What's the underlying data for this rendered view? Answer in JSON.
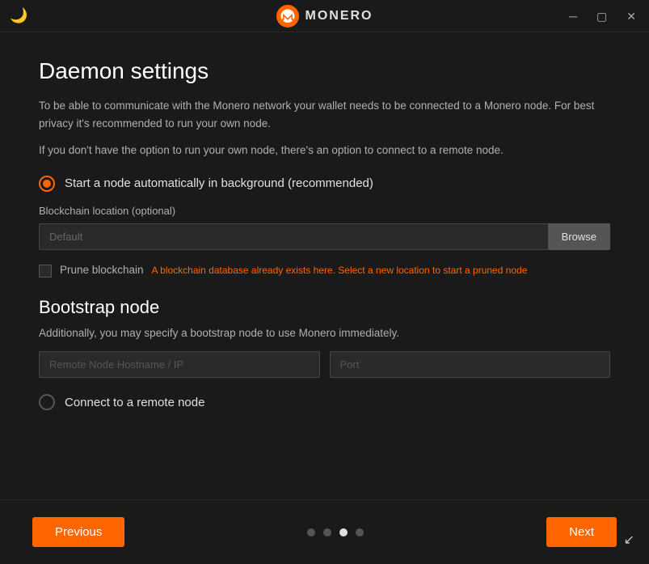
{
  "titleBar": {
    "appName": "MONERO",
    "minimizeLabel": "─",
    "maximizeLabel": "▢",
    "closeLabel": "✕",
    "moonIcon": "🌙"
  },
  "page": {
    "title": "Daemon settings",
    "description1": "To be able to communicate with the Monero network your wallet needs to be connected to a Monero node. For best privacy it's recommended to run your own node.",
    "description2": "If you don't have the option to run your own node, there's an option to connect to a remote node.",
    "autoStartOption": {
      "label": "Start a node automatically in background (recommended)",
      "selected": true
    },
    "blockchainLocation": {
      "label": "Blockchain location (optional)",
      "placeholder": "Default",
      "browseBtn": "Browse"
    },
    "pruneBlockchain": {
      "label": "Prune blockchain",
      "hint": "A blockchain database already exists here. Select a new location to start a pruned node"
    },
    "bootstrapNode": {
      "title": "Bootstrap node",
      "description": "Additionally, you may specify a bootstrap node to use Monero immediately.",
      "hostnameField": {
        "placeholder": "Remote Node Hostname / IP"
      },
      "portField": {
        "placeholder": "Port"
      }
    },
    "connectRemote": {
      "label": "Connect to a remote node",
      "selected": false
    }
  },
  "footer": {
    "previousBtn": "Previous",
    "nextBtn": "Next",
    "pagination": {
      "total": 4,
      "activeIndex": 2
    }
  }
}
